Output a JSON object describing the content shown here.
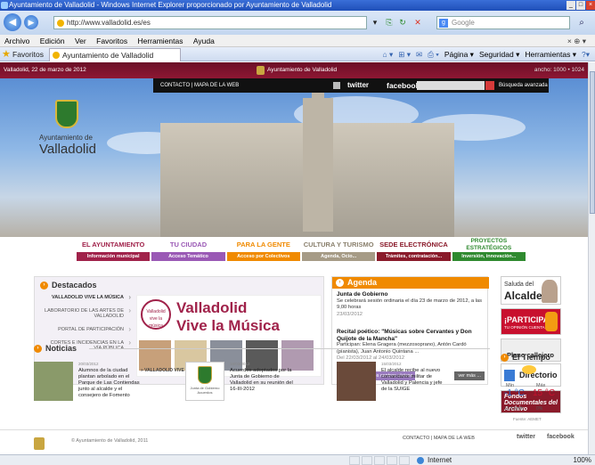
{
  "window": {
    "title": "Ayuntamiento de Valladolid - Windows Internet Explorer proporcionado por Ayuntamiento de Valladolid"
  },
  "address": {
    "url": "http://www.valladolid.es/es",
    "search_placeholder": "Google"
  },
  "menu": [
    "Archivo",
    "Edición",
    "Ver",
    "Favoritos",
    "Herramientas",
    "Ayuda"
  ],
  "favbar": {
    "favorites_label": "Favoritos",
    "tab_title": "Ayuntamiento de Valladolid",
    "commands": [
      "Página ▾",
      "Seguridad ▾",
      "Herramientas ▾"
    ]
  },
  "site": {
    "date": "Valladolid, 22 de marzo de 2012",
    "center_title": "Ayuntamiento de Valladolid",
    "resolution": "ancho: 1000 • 1024",
    "logo_line1": "Ayuntamiento de",
    "logo_line2": "Valladolid",
    "top_links": "CONTACTO  |  MAPA DE LA WEB",
    "twitter": "twitter",
    "facebook": "facebook",
    "advanced_search": "Búsqueda avanzada"
  },
  "nav": [
    {
      "title": "EL AYUNTAMIENTO",
      "sub": "Información municipal",
      "color": "#a0224a"
    },
    {
      "title": "TU CIUDAD",
      "sub": "Acceso Temático",
      "color": "#9a59b5"
    },
    {
      "title": "PARA LA GENTE",
      "sub": "Acceso por Colectivos",
      "color": "#f08a00"
    },
    {
      "title": "CULTURA Y TURISMO",
      "sub": "Agenda, Ocio...",
      "color": "#a69b86"
    },
    {
      "title": "SEDE ELECTRÓNICA",
      "sub": "Trámites, contratación...",
      "color": "#8a1a2a"
    },
    {
      "title": "PROYECTOS ESTRATÉGICOS",
      "sub": "Inversión, innovación...",
      "color": "#2f8a2f"
    }
  ],
  "destacados": {
    "title": "Destacados",
    "links": [
      "VALLADOLID VIVE LA MÚSICA",
      "LABORATORIO DE LAS ARTES DE VALLADOLID",
      "PORTAL DE PARTICIPACIÓN",
      "CORTES E INCIDENCIAS EN LA VÍA PÚBLICA"
    ],
    "banner_line1": "Valladolid",
    "banner_line2": "Vive la Música",
    "round_text": "Valladolid vive la música",
    "caption": "» VALLADOLID VIVE LA MÚSICA"
  },
  "agenda": {
    "title": "Agenda",
    "items": [
      {
        "title": "Junta de Gobierno",
        "text": "Se celebrará sesión ordinaria el día 23 de marzo de 2012, a las 9,00 horas",
        "date": "23/03/2012"
      },
      {
        "title": "Recital poético: \"Músicas sobre Cervantes y Don Quijote de la Mancha\"",
        "text": "Participan: Elena Gragera (mezzosoprano), Antón Cardó (pianista), Juan Antonio Quintana ...",
        "date": "Del 22/03/2012 al 24/03/2012"
      }
    ],
    "btn_left": "Actividades de los centros cívicos",
    "btn_right": "ver más ..."
  },
  "right": {
    "saluda1": "Saluda del",
    "saluda2": "Alcalde",
    "participa1": "¡PARTICIPA!",
    "participa2": "TU OPINIÓN CUENTA",
    "plano": "Plano callejero",
    "directorio": "Directorio",
    "fondos": "Fondos Documentales del Archivo"
  },
  "tiempo": {
    "title": "El Tiempo",
    "min_label": "Mín",
    "max_label": "Máx",
    "min_val": "-1 °C",
    "max_val": "15 °C",
    "wind": "10.6 km/h",
    "rain": "0%",
    "source": "Fuente: AEMET"
  },
  "noticias": {
    "title": "Noticias",
    "items": [
      {
        "date": "20/03/2012",
        "text": "Alumnos de la ciudad plantan arbolado en el Parque de Las Contiendas junto al alcalde y el consejero de Fomento"
      },
      {
        "date": "16/03/2012",
        "text": "Acuerdos adoptados por la Junta de Gobierno de Valladolid en su reunión del 16-III-2012",
        "img_text": "Junta de Gobierno Acuerdos"
      },
      {
        "date": "15/03/2012",
        "text": "El alcalde recibe al nuevo comandante militar de Valladolid y Palencia y jefe de la SUIGE"
      }
    ]
  },
  "footer": {
    "copyright": "© Ayuntamiento de Valladolid, 2011",
    "links": "CONTACTO  |  MAPA DE LA WEB",
    "twitter": "twitter",
    "facebook": "facebook"
  },
  "status": {
    "zone": "Internet",
    "zoom": "100%"
  }
}
